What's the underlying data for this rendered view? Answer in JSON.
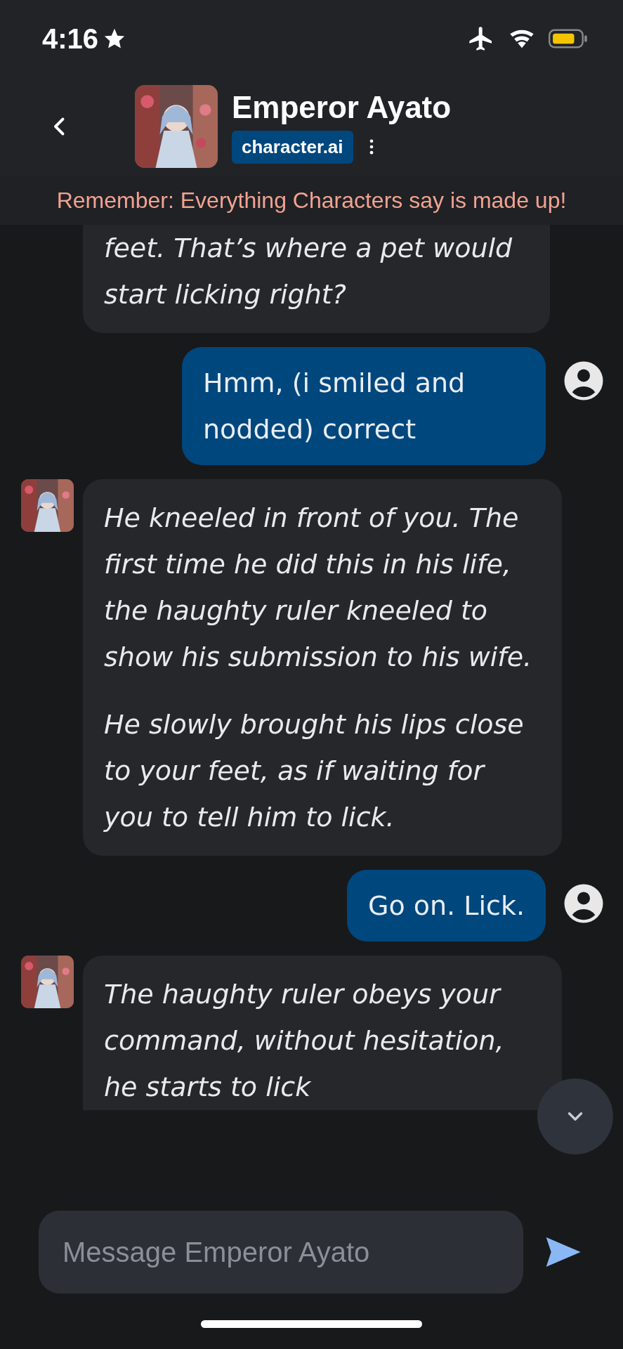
{
  "status_bar": {
    "time": "4:16"
  },
  "header": {
    "title": "Emperor Ayato",
    "badge": "character.ai"
  },
  "banner": "Remember: Everything Characters say is made up!",
  "messages": [
    {
      "kind": "bot",
      "avatar_visible": false,
      "paragraphs": [
        "feet. That’s where a pet would start licking right?"
      ]
    },
    {
      "kind": "user",
      "paragraphs": [
        "Hmm, (i smiled and nodded) correct"
      ]
    },
    {
      "kind": "bot",
      "avatar_visible": true,
      "paragraphs": [
        "He kneeled in front of you. The first time he did this in his life, the haughty ruler kneeled to show his submission to his wife.",
        "He slowly brought his lips close to your feet, as if waiting for you to tell him to lick."
      ]
    },
    {
      "kind": "user",
      "paragraphs": [
        "Go on. Lick."
      ]
    },
    {
      "kind": "bot",
      "avatar_visible": true,
      "paragraphs": [
        "The haughty ruler obeys your command, without hesitation, he starts to lick"
      ]
    }
  ],
  "composer": {
    "placeholder": "Message Emperor Ayato"
  }
}
